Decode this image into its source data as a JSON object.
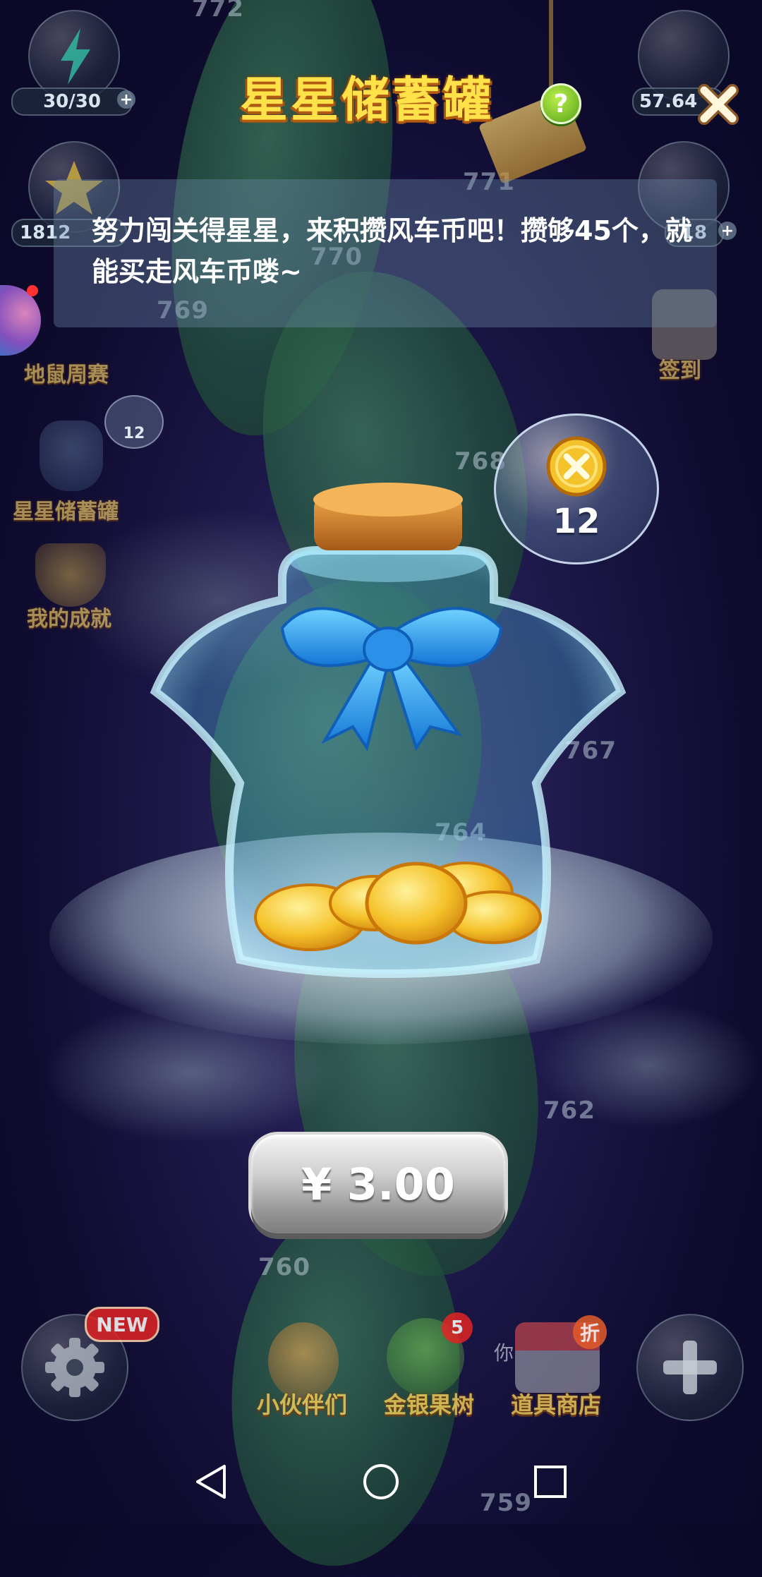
{
  "hud": {
    "energy": "30/30",
    "stars": "1812",
    "coins_top": "57.64",
    "coins_second": "18",
    "plus": "+"
  },
  "map": {
    "levels": [
      "772",
      "771",
      "770",
      "769",
      "768",
      "767",
      "764",
      "762",
      "760",
      "759"
    ]
  },
  "side_menu": {
    "weekly_race": "地鼠周赛",
    "piggy_bank": "星星储蓄罐",
    "piggy_badge": "12",
    "achievements": "我的成就",
    "sign_in": "签到"
  },
  "dialog": {
    "title": "星星储蓄罐",
    "help": "?",
    "description": "努力闯关得星星，来积攒风车币吧！攒够45个，就能买走风车币喽~",
    "coin_count": "12",
    "price_button": "¥ 3.00"
  },
  "bottom_bar": {
    "new_badge": "NEW",
    "partners": "小伙伴们",
    "money_tree": "金银果树",
    "money_tree_badge": "5",
    "shop": "道具商店",
    "shop_badge": "折",
    "partial_text": "你"
  },
  "icons": {
    "energy": "lightning-icon",
    "star": "star-icon",
    "coin": "windmill-coin-icon",
    "settings": "gear-icon",
    "add": "plus-icon",
    "close": "close-icon",
    "nav_back": "triangle-back-icon",
    "nav_home": "circle-home-icon",
    "nav_recent": "square-recent-icon"
  },
  "colors": {
    "title": "#ffe24a",
    "background": "#1c1848",
    "help_button": "#57a21a",
    "badge_red": "#e02424"
  }
}
